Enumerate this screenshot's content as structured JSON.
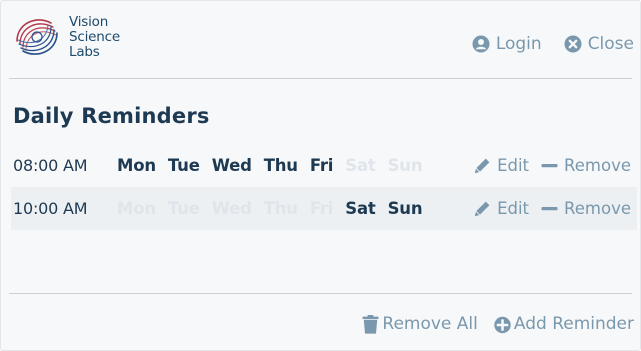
{
  "brand": {
    "name_lines": [
      "Vision",
      "Science",
      "Labs"
    ],
    "colors": {
      "text": "#1d4a6b",
      "red": "#b4384a",
      "blue": "#2a4f8a"
    }
  },
  "header": {
    "login": {
      "label": "Login",
      "icon": "user-circle-icon"
    },
    "close": {
      "label": "Close",
      "icon": "close-circle-icon"
    }
  },
  "page": {
    "title": "Daily Reminders"
  },
  "reminders": [
    {
      "time": "08:00 AM",
      "days": [
        {
          "label": "Mon",
          "active": true
        },
        {
          "label": "Tue",
          "active": true
        },
        {
          "label": "Wed",
          "active": true
        },
        {
          "label": "Thu",
          "active": true
        },
        {
          "label": "Fri",
          "active": true
        },
        {
          "label": "Sat",
          "active": false
        },
        {
          "label": "Sun",
          "active": false
        }
      ],
      "edit_label": "Edit",
      "remove_label": "Remove"
    },
    {
      "time": "10:00 AM",
      "days": [
        {
          "label": "Mon",
          "active": false
        },
        {
          "label": "Tue",
          "active": false
        },
        {
          "label": "Wed",
          "active": false
        },
        {
          "label": "Thu",
          "active": false
        },
        {
          "label": "Fri",
          "active": false
        },
        {
          "label": "Sat",
          "active": true
        },
        {
          "label": "Sun",
          "active": true
        }
      ],
      "edit_label": "Edit",
      "remove_label": "Remove"
    }
  ],
  "footer": {
    "remove_all": {
      "label": "Remove All",
      "icon": "trash-icon"
    },
    "add_reminder": {
      "label": "Add Reminder",
      "icon": "plus-circle-icon"
    }
  },
  "colors": {
    "heading": "#1e3a52",
    "action": "#7a98ad",
    "day_active": "#1e3a52",
    "day_inactive": "#dfe5ea",
    "alt_row": "#ecf0f3",
    "divider": "#c9d0d6"
  }
}
